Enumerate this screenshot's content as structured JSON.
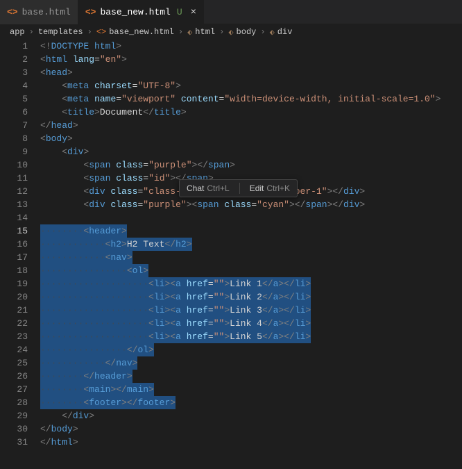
{
  "tabs": {
    "inactive": {
      "label": "base.html"
    },
    "active": {
      "label": "base_new.html",
      "git": "U"
    }
  },
  "breadcrumb": {
    "seg0": "app",
    "seg1": "templates",
    "seg2": "base_new.html",
    "seg3": "html",
    "seg4": "body",
    "seg5": "div"
  },
  "tooltip": {
    "chat": "Chat",
    "chat_kb": "Ctrl+L",
    "edit": "Edit",
    "edit_kb": "Ctrl+K"
  },
  "numbers": {
    "l1": "1",
    "l2": "2",
    "l3": "3",
    "l4": "4",
    "l5": "5",
    "l6": "6",
    "l7": "7",
    "l8": "8",
    "l9": "9",
    "l10": "10",
    "l11": "11",
    "l12": "12",
    "l13": "13",
    "l14": "14",
    "l15": "15",
    "l16": "16",
    "l17": "17",
    "l18": "18",
    "l19": "19",
    "l20": "20",
    "l21": "21",
    "l22": "22",
    "l23": "23",
    "l24": "24",
    "l25": "25",
    "l26": "26",
    "l27": "27",
    "l28": "28",
    "l29": "29",
    "l30": "30",
    "l31": "31"
  },
  "code": {
    "doctype": "DOCTYPE",
    "html": "html",
    "lang": "lang",
    "en": "\"en\"",
    "head": "head",
    "meta": "meta",
    "charset": "charset",
    "utf8": "\"UTF-8\"",
    "name": "name",
    "viewport": "\"viewport\"",
    "content": "content",
    "contentval": "\"width=device-width, initial-scale=1.0\"",
    "title": "title",
    "document": "Document",
    "body": "body",
    "div": "div",
    "span": "span",
    "class": "class",
    "purple": "\"purple\"",
    "id_attr": "id",
    "id_str": "\"id\"",
    "class12": "\"class-1 class-2\"",
    "idnum": "\"id-number-1\"",
    "cyan": "\"cyan\"",
    "header": "header",
    "h2": "h2",
    "h2text": "H2 Text",
    "nav": "nav",
    "ol": "ol",
    "li": "li",
    "a": "a",
    "href": "href",
    "empty": "\"\"",
    "link1": "Link 1",
    "link2": "Link 2",
    "link3": "Link 3",
    "link4": "Link 4",
    "link5": "Link 5",
    "main": "main",
    "footer": "footer"
  }
}
